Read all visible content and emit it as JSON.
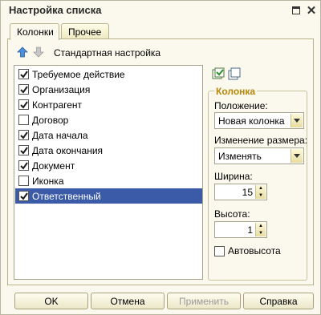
{
  "window": {
    "title": "Настройка списка"
  },
  "tabs": [
    {
      "label": "Колонки",
      "active": true
    },
    {
      "label": "Прочее",
      "active": false
    }
  ],
  "toolbar": {
    "move_up_icon": "arrow-up-icon",
    "move_down_icon": "arrow-down-icon",
    "standard_label": "Стандартная настройка"
  },
  "columns": [
    {
      "label": "Требуемое действие",
      "checked": true
    },
    {
      "label": "Организация",
      "checked": true
    },
    {
      "label": "Контрагент",
      "checked": true
    },
    {
      "label": "Договор",
      "checked": false
    },
    {
      "label": "Дата начала",
      "checked": true
    },
    {
      "label": "Дата окончания",
      "checked": true
    },
    {
      "label": "Документ",
      "checked": true
    },
    {
      "label": "Иконка",
      "checked": false
    },
    {
      "label": "Ответственный",
      "checked": true,
      "selected": true
    }
  ],
  "column_group": {
    "title": "Колонка",
    "position_label": "Положение:",
    "position_value": "Новая колонка",
    "resize_label": "Изменение размера:",
    "resize_value": "Изменять",
    "width_label": "Ширина:",
    "width_value": "15",
    "height_label": "Высота:",
    "height_value": "1",
    "autoheight_label": "Автовысота",
    "autoheight_checked": false
  },
  "buttons": {
    "ok": "OK",
    "cancel": "Отмена",
    "apply": "Применить",
    "help": "Справка"
  },
  "colors": {
    "accent_title": "#b8860b",
    "selection": "#3b5aa8",
    "background": "#fbf9ed"
  }
}
